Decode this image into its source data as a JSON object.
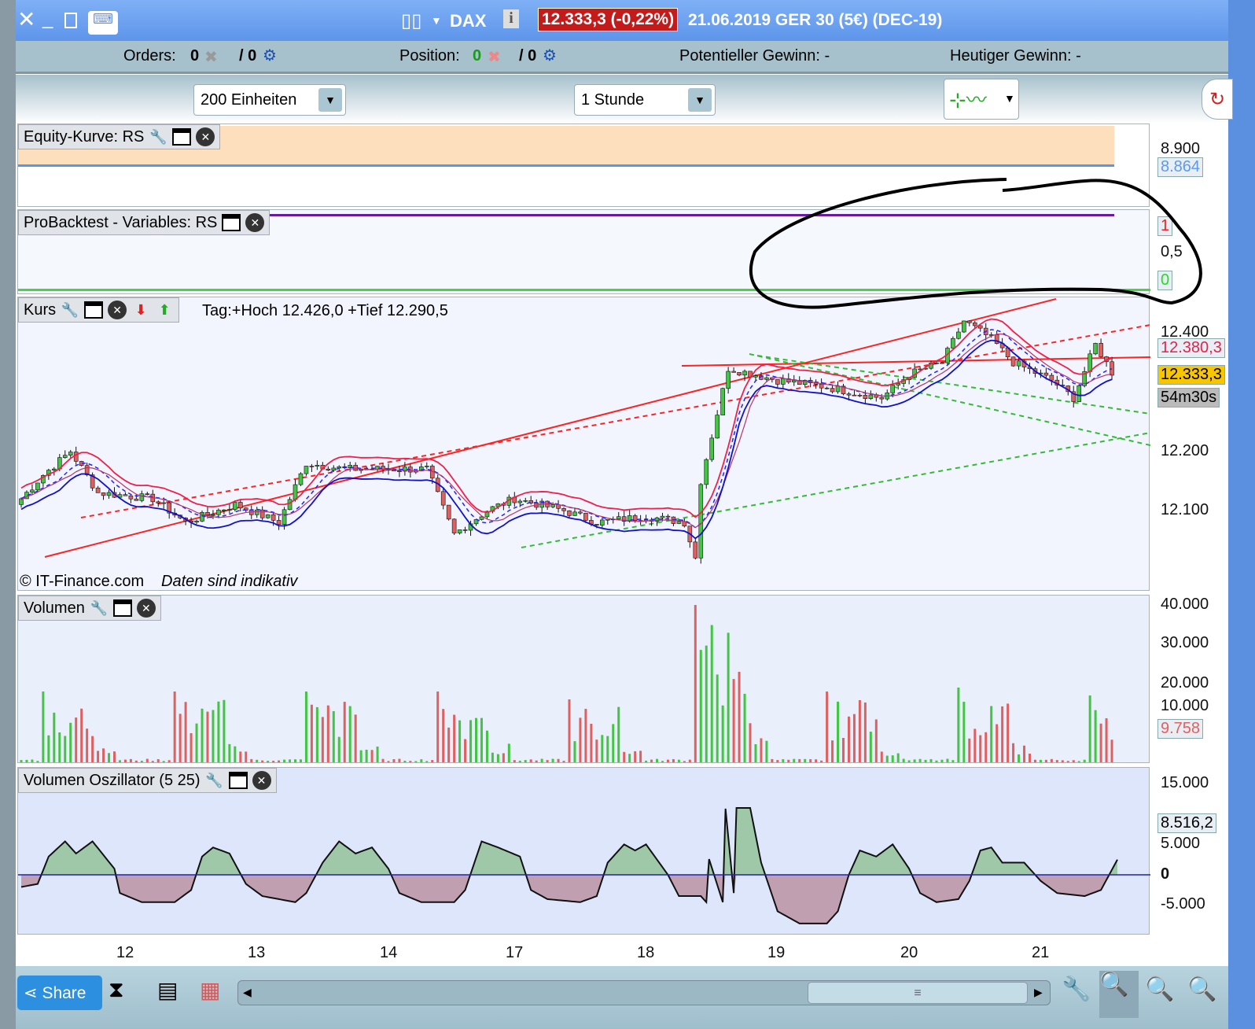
{
  "window": {
    "symbol": "DAX",
    "price_badge": "12.333,3 (-0,22%)",
    "title_rest": "21.06.2019 GER 30 (5€) (DEC-19)"
  },
  "infobar": {
    "orders_label": "Orders:",
    "orders_value": "0",
    "orders_slash": "/ 0",
    "position_label": "Position:",
    "position_value": "0",
    "position_slash": "/ 0",
    "pot_gain": "Potentieller Gewinn: -",
    "today_gain": "Heutiger Gewinn: -"
  },
  "toolbar": {
    "units": "200 Einheiten",
    "interval": "1 Stunde"
  },
  "panels": {
    "equity": "Equity-Kurve: RS",
    "probacktest": "ProBacktest - Variables: RS",
    "kurs": "Kurs",
    "kurs_info": "Tag:+Hoch 12.426,0 +Tief 12.290,5",
    "copyright": "© IT-Finance.com",
    "indicative": "Daten sind indikativ",
    "volumen": "Volumen",
    "oscillator": "Volumen Oszillator (5 25)"
  },
  "axes": {
    "equity": [
      "8.900"
    ],
    "equity_tag": "8.864",
    "backtest": [
      "0,5"
    ],
    "backtest_tag_top": "1",
    "backtest_tag_bottom": "0",
    "price": [
      "12.400",
      "12.200",
      "12.100"
    ],
    "price_tag_red": "12.380,3",
    "price_tag_current": "12.333,3",
    "price_tag_timer": "54m30s",
    "volume": [
      "40.000",
      "30.000",
      "20.000",
      "10.000"
    ],
    "volume_tag": "9.758",
    "osc": [
      "15.000",
      "5.000",
      "0",
      "-5.000"
    ],
    "osc_tag": "8.516,2",
    "x": [
      "12",
      "13",
      "14",
      "17",
      "18",
      "19",
      "20",
      "21"
    ]
  },
  "bottom": {
    "share": "Share"
  },
  "colors": {
    "up": "#44c444",
    "down": "#e06060",
    "accent": "#5e95ea"
  },
  "chart_data": {
    "type": "candlestick",
    "candles": 200,
    "price_path": [
      [
        0,
        12110
      ],
      [
        5,
        12160
      ],
      [
        10,
        12200
      ],
      [
        15,
        12130
      ],
      [
        25,
        12120
      ],
      [
        31,
        12080
      ],
      [
        40,
        12110
      ],
      [
        48,
        12080
      ],
      [
        53,
        12180
      ],
      [
        60,
        12170
      ],
      [
        69,
        12170
      ],
      [
        75,
        12170
      ],
      [
        80,
        12060
      ],
      [
        86,
        12100
      ],
      [
        91,
        12120
      ],
      [
        100,
        12100
      ],
      [
        106,
        12080
      ],
      [
        115,
        12090
      ],
      [
        122,
        12080
      ],
      [
        124,
        12020
      ],
      [
        125,
        12150
      ],
      [
        130,
        12340
      ],
      [
        139,
        12320
      ],
      [
        147,
        12310
      ],
      [
        158,
        12290
      ],
      [
        163,
        12330
      ],
      [
        169,
        12350
      ],
      [
        173,
        12420
      ],
      [
        178,
        12390
      ],
      [
        182,
        12350
      ],
      [
        189,
        12320
      ],
      [
        193,
        12290
      ],
      [
        197,
        12380
      ],
      [
        200,
        12333
      ]
    ],
    "volume_sessions": [
      {
        "start": 4,
        "peak": 18000
      },
      {
        "start": 28,
        "peak": 18000
      },
      {
        "start": 52,
        "peak": 18000
      },
      {
        "start": 76,
        "peak": 18000
      },
      {
        "start": 100,
        "peak": 16000
      },
      {
        "start": 123,
        "peak": 40000
      },
      {
        "start": 147,
        "peak": 18000
      },
      {
        "start": 171,
        "peak": 19000
      },
      {
        "start": 195,
        "peak": 17000
      }
    ],
    "osc_path": [
      [
        0,
        -2000
      ],
      [
        3,
        -1500
      ],
      [
        5,
        3000
      ],
      [
        8,
        5500
      ],
      [
        10,
        3500
      ],
      [
        13,
        5500
      ],
      [
        17,
        1000
      ],
      [
        18,
        -3000
      ],
      [
        22,
        -4500
      ],
      [
        28,
        -4500
      ],
      [
        31,
        -2500
      ],
      [
        33,
        3000
      ],
      [
        35,
        4500
      ],
      [
        38,
        3500
      ],
      [
        41,
        -1500
      ],
      [
        44,
        -3500
      ],
      [
        50,
        -4500
      ],
      [
        52,
        -3000
      ],
      [
        55,
        2000
      ],
      [
        58,
        5500
      ],
      [
        61,
        3500
      ],
      [
        64,
        4500
      ],
      [
        67,
        1000
      ],
      [
        69,
        -3000
      ],
      [
        73,
        -4500
      ],
      [
        79,
        -4500
      ],
      [
        81,
        -2500
      ],
      [
        84,
        5500
      ],
      [
        87,
        4500
      ],
      [
        91,
        3000
      ],
      [
        93,
        -2500
      ],
      [
        96,
        -4000
      ],
      [
        102,
        -4500
      ],
      [
        105,
        -3500
      ],
      [
        107,
        2000
      ],
      [
        110,
        5000
      ],
      [
        112,
        4000
      ],
      [
        114,
        5000
      ],
      [
        118,
        0
      ],
      [
        120,
        -3500
      ],
      [
        125,
        -4500
      ],
      [
        128,
        -4500
      ],
      [
        130,
        -3000
      ],
      [
        124,
        -3500
      ],
      [
        125,
        4000
      ],
      [
        128,
        15500
      ],
      [
        130,
        11000
      ],
      [
        133,
        11000
      ],
      [
        135,
        2000
      ],
      [
        138,
        -6000
      ],
      [
        142,
        -8000
      ],
      [
        147,
        -8000
      ],
      [
        149,
        -6000
      ],
      [
        151,
        0
      ],
      [
        153,
        4000
      ],
      [
        156,
        3000
      ],
      [
        159,
        5000
      ],
      [
        162,
        1000
      ],
      [
        164,
        -3000
      ],
      [
        167,
        -4500
      ],
      [
        171,
        -4000
      ],
      [
        173,
        -1000
      ],
      [
        175,
        4000
      ],
      [
        177,
        4500
      ],
      [
        179,
        2000
      ],
      [
        183,
        2000
      ],
      [
        186,
        -1000
      ],
      [
        189,
        -3000
      ],
      [
        194,
        -3500
      ],
      [
        197,
        -2500
      ],
      [
        200,
        2500
      ],
      [
        203,
        7500
      ],
      [
        205,
        8516
      ]
    ],
    "price_ylim": [
      11980,
      12450
    ],
    "volume_ylim": [
      0,
      40000
    ],
    "osc_ylim": [
      -9000,
      16000
    ]
  }
}
